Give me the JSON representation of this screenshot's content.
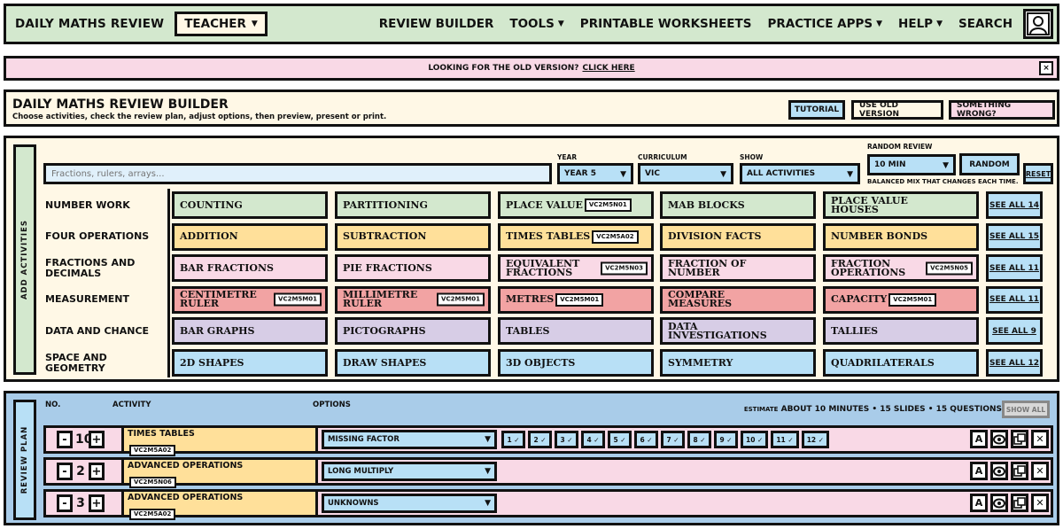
{
  "nav": {
    "brand": "DAILY MATHS REVIEW",
    "role": "TEACHER",
    "links": [
      {
        "label": "REVIEW BUILDER",
        "dropdown": false
      },
      {
        "label": "TOOLS",
        "dropdown": true
      },
      {
        "label": "PRINTABLE WORKSHEETS",
        "dropdown": false
      },
      {
        "label": "PRACTICE APPS",
        "dropdown": true
      },
      {
        "label": "HELP",
        "dropdown": true
      },
      {
        "label": "SEARCH",
        "dropdown": false
      }
    ]
  },
  "banner": {
    "text": "LOOKING FOR THE OLD VERSION?",
    "link": "CLICK HERE",
    "close": "×"
  },
  "header": {
    "title": "DAILY MATHS REVIEW BUILDER",
    "subtitle": "Choose activities, check the review plan, adjust options, then preview, present or print.",
    "tutorial": "TUTORIAL",
    "old_version": "USE OLD VERSION",
    "something_wrong": "SOMETHING WRONG?"
  },
  "add_panel": {
    "side_label": "ADD ACTIVITIES",
    "search_placeholder": "Fractions, rulers, arrays...",
    "year_label": "YEAR",
    "year_value": "YEAR 5",
    "curriculum_label": "CURRICULUM",
    "curriculum_value": "VIC",
    "show_label": "SHOW",
    "show_value": "ALL ACTIVITIES",
    "random_label": "RANDOM REVIEW",
    "random_duration": "10 MIN",
    "random_button": "RANDOM",
    "reset_button": "RESET",
    "random_note": "BALANCED MIX THAT CHANGES EACH TIME."
  },
  "categories": [
    {
      "name": "NUMBER WORK",
      "see_all": "SEE ALL 14",
      "tiles": [
        {
          "label": "COUNTING",
          "code": "",
          "color": "#d3e8ce"
        },
        {
          "label": "PARTITIONING",
          "code": "",
          "color": "#d3e8ce"
        },
        {
          "label": "PLACE VALUE",
          "code": "VC2M5N01",
          "color": "#d3e8ce"
        },
        {
          "label": "MAB BLOCKS",
          "code": "",
          "color": "#d3e8ce"
        },
        {
          "label": "PLACE VALUE HOUSES",
          "code": "",
          "color": "#d3e8ce"
        }
      ]
    },
    {
      "name": "FOUR OPERATIONS",
      "see_all": "SEE ALL 15",
      "tiles": [
        {
          "label": "ADDITION",
          "code": "",
          "color": "#ffe09a"
        },
        {
          "label": "SUBTRACTION",
          "code": "",
          "color": "#ffe09a"
        },
        {
          "label": "TIMES TABLES",
          "code": "VC2M5A02",
          "color": "#ffe09a"
        },
        {
          "label": "DIVISION FACTS",
          "code": "",
          "color": "#ffe09a"
        },
        {
          "label": "NUMBER BONDS",
          "code": "",
          "color": "#ffe09a"
        }
      ]
    },
    {
      "name": "FRACTIONS AND DECIMALS",
      "see_all": "SEE ALL 11",
      "tiles": [
        {
          "label": "BAR FRACTIONS",
          "code": "",
          "color": "#f9d9e6"
        },
        {
          "label": "PIE FRACTIONS",
          "code": "",
          "color": "#f9d9e6"
        },
        {
          "label": "EQUIVALENT FRACTIONS",
          "code": "VC2M5N03",
          "color": "#f9d9e6"
        },
        {
          "label": "FRACTION OF NUMBER",
          "code": "",
          "color": "#f9d9e6"
        },
        {
          "label": "FRACTION OPERATIONS",
          "code": "VC2M5N05",
          "color": "#f9d9e6"
        }
      ]
    },
    {
      "name": "MEASUREMENT",
      "see_all": "SEE ALL 11",
      "tiles": [
        {
          "label": "CENTIMETRE RULER",
          "code": "VC2M5M01",
          "color": "#f2a3a3"
        },
        {
          "label": "MILLIMETRE RULER",
          "code": "VC2M5M01",
          "color": "#f2a3a3"
        },
        {
          "label": "METRES",
          "code": "VC2M5M01",
          "color": "#f2a3a3"
        },
        {
          "label": "COMPARE MEASURES",
          "code": "",
          "color": "#f2a3a3"
        },
        {
          "label": "CAPACITY",
          "code": "VC2M5M01",
          "color": "#f2a3a3"
        }
      ]
    },
    {
      "name": "DATA AND CHANCE",
      "see_all": "SEE ALL 9",
      "tiles": [
        {
          "label": "BAR GRAPHS",
          "code": "",
          "color": "#d7cde6"
        },
        {
          "label": "PICTOGRAPHS",
          "code": "",
          "color": "#d7cde6"
        },
        {
          "label": "TABLES",
          "code": "",
          "color": "#d7cde6"
        },
        {
          "label": "DATA INVESTIGATIONS",
          "code": "",
          "color": "#d7cde6"
        },
        {
          "label": "TALLIES",
          "code": "",
          "color": "#d7cde6"
        }
      ]
    },
    {
      "name": "SPACE AND GEOMETRY",
      "see_all": "SEE ALL 12",
      "tiles": [
        {
          "label": "2D SHAPES",
          "code": "",
          "color": "#b8e0f6"
        },
        {
          "label": "DRAW SHAPES",
          "code": "",
          "color": "#b8e0f6"
        },
        {
          "label": "3D OBJECTS",
          "code": "",
          "color": "#b8e0f6"
        },
        {
          "label": "SYMMETRY",
          "code": "",
          "color": "#b8e0f6"
        },
        {
          "label": "QUADRILATERALS",
          "code": "",
          "color": "#b8e0f6"
        }
      ]
    }
  ],
  "plan": {
    "side_label": "REVIEW PLAN",
    "col_no": "NO.",
    "col_activity": "ACTIVITY",
    "col_options": "OPTIONS",
    "estimate_label": "ESTIMATE",
    "estimate": "ABOUT 10 MINUTES • 15 SLIDES • 15 QUESTIONS",
    "show_all": "SHOW ALL",
    "rows": [
      {
        "no": "10",
        "activity": "TIMES TABLES",
        "code": "VC2M5A02",
        "option": "MISSING FACTOR",
        "chips": [
          "1 ✓",
          "2 ✓",
          "3 ✓",
          "4 ✓",
          "5 ✓",
          "6 ✓",
          "7 ✓",
          "8 ✓",
          "9 ✓",
          "10 ✓",
          "11 ✓",
          "12 ✓"
        ]
      },
      {
        "no": "2",
        "activity": "ADVANCED OPERATIONS",
        "code": "VC2M5N06",
        "option": "LONG MULTIPLY",
        "chips": []
      },
      {
        "no": "3",
        "activity": "ADVANCED OPERATIONS",
        "code": "VC2M5A02",
        "option": "UNKNOWNS",
        "chips": []
      }
    ],
    "row_actions": [
      "A",
      "",
      "",
      "✕"
    ]
  }
}
